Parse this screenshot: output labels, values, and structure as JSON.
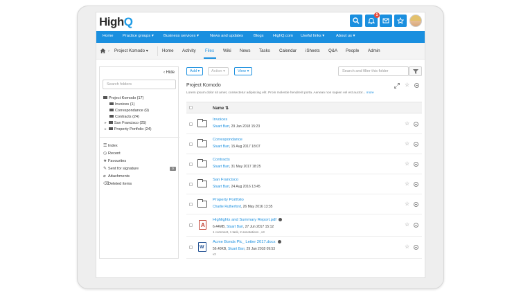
{
  "app": {
    "logo_main": "High",
    "logo_accent": "Q",
    "notification_count": "1"
  },
  "mainnav": [
    "Home",
    "Practice groups ▾",
    "Business services ▾",
    "News and updates",
    "Blogs",
    "HighQ.com",
    "Useful links ▾",
    "About us ▾"
  ],
  "subnav": {
    "project": "Project Komodo ▾",
    "tabs": [
      "Home",
      "Activity",
      "Files",
      "Wiki",
      "News",
      "Tasks",
      "Calendar",
      "iSheets",
      "Q&A",
      "People",
      "Admin"
    ]
  },
  "sidebar": {
    "hide_label": "‹ Hide",
    "search_placeholder": "Search folders",
    "tree": [
      "Project Komodo (17)",
      "Invoices (1)",
      "Correspondance (9)",
      "Contracts (24)",
      "San Francisco (25)",
      "Property Portfolio (24)"
    ],
    "links": [
      "Index",
      "Recent",
      "Favourites",
      "Sent for signature",
      "Attachments",
      "Deleted items"
    ],
    "signature_count": "0"
  },
  "toolbar": {
    "add": "Add ▾",
    "action": "Action ▾",
    "view": "View ▾",
    "filter_placeholder": "Search and filter this folder"
  },
  "folder": {
    "title": "Project Komodo",
    "description": "Lorem ipsum dolor sit amet, consectetur adipiscing elit. Proin molestie hendrerit porta. Aenean non sapien vel est auctor...",
    "more": "more"
  },
  "table": {
    "name_header": "Name ⇅"
  },
  "rows": [
    {
      "name": "Invoices",
      "user": "Stuart Barr",
      "date": ", 29 Jan 2018 15:23",
      "size": "",
      "extra": ""
    },
    {
      "name": "Correspondance",
      "user": "Stuart Barr",
      "date": ", 15 Aug 2017 18:07",
      "size": "",
      "extra": ""
    },
    {
      "name": "Contracts",
      "user": "Stuart Barr",
      "date": ", 31 May 2017 18:25",
      "size": "",
      "extra": ""
    },
    {
      "name": "San Francisco",
      "user": "Stuart Barr",
      "date": ", 24 Aug 2016 13:45",
      "size": "",
      "extra": ""
    },
    {
      "name": "Property Portfolio",
      "user": "Charlie Rutherford",
      "date": ", 26 May 2016 13:35",
      "size": "",
      "extra": ""
    },
    {
      "name": "Highlights and Summary Report.pdf",
      "user": "Stuart Barr",
      "date": ", 27 Jun 2017 15:12",
      "size": "6.44MB, ",
      "extra": "1 comment, 1 task, 2 annotations , v3"
    },
    {
      "name": "Acme Bonds Plc_ Letter 2017.docx",
      "user": "Stuart Barr",
      "date": ", 29 Jan 2018 09:53",
      "size": "56.40KB, ",
      "extra": "v2"
    }
  ]
}
